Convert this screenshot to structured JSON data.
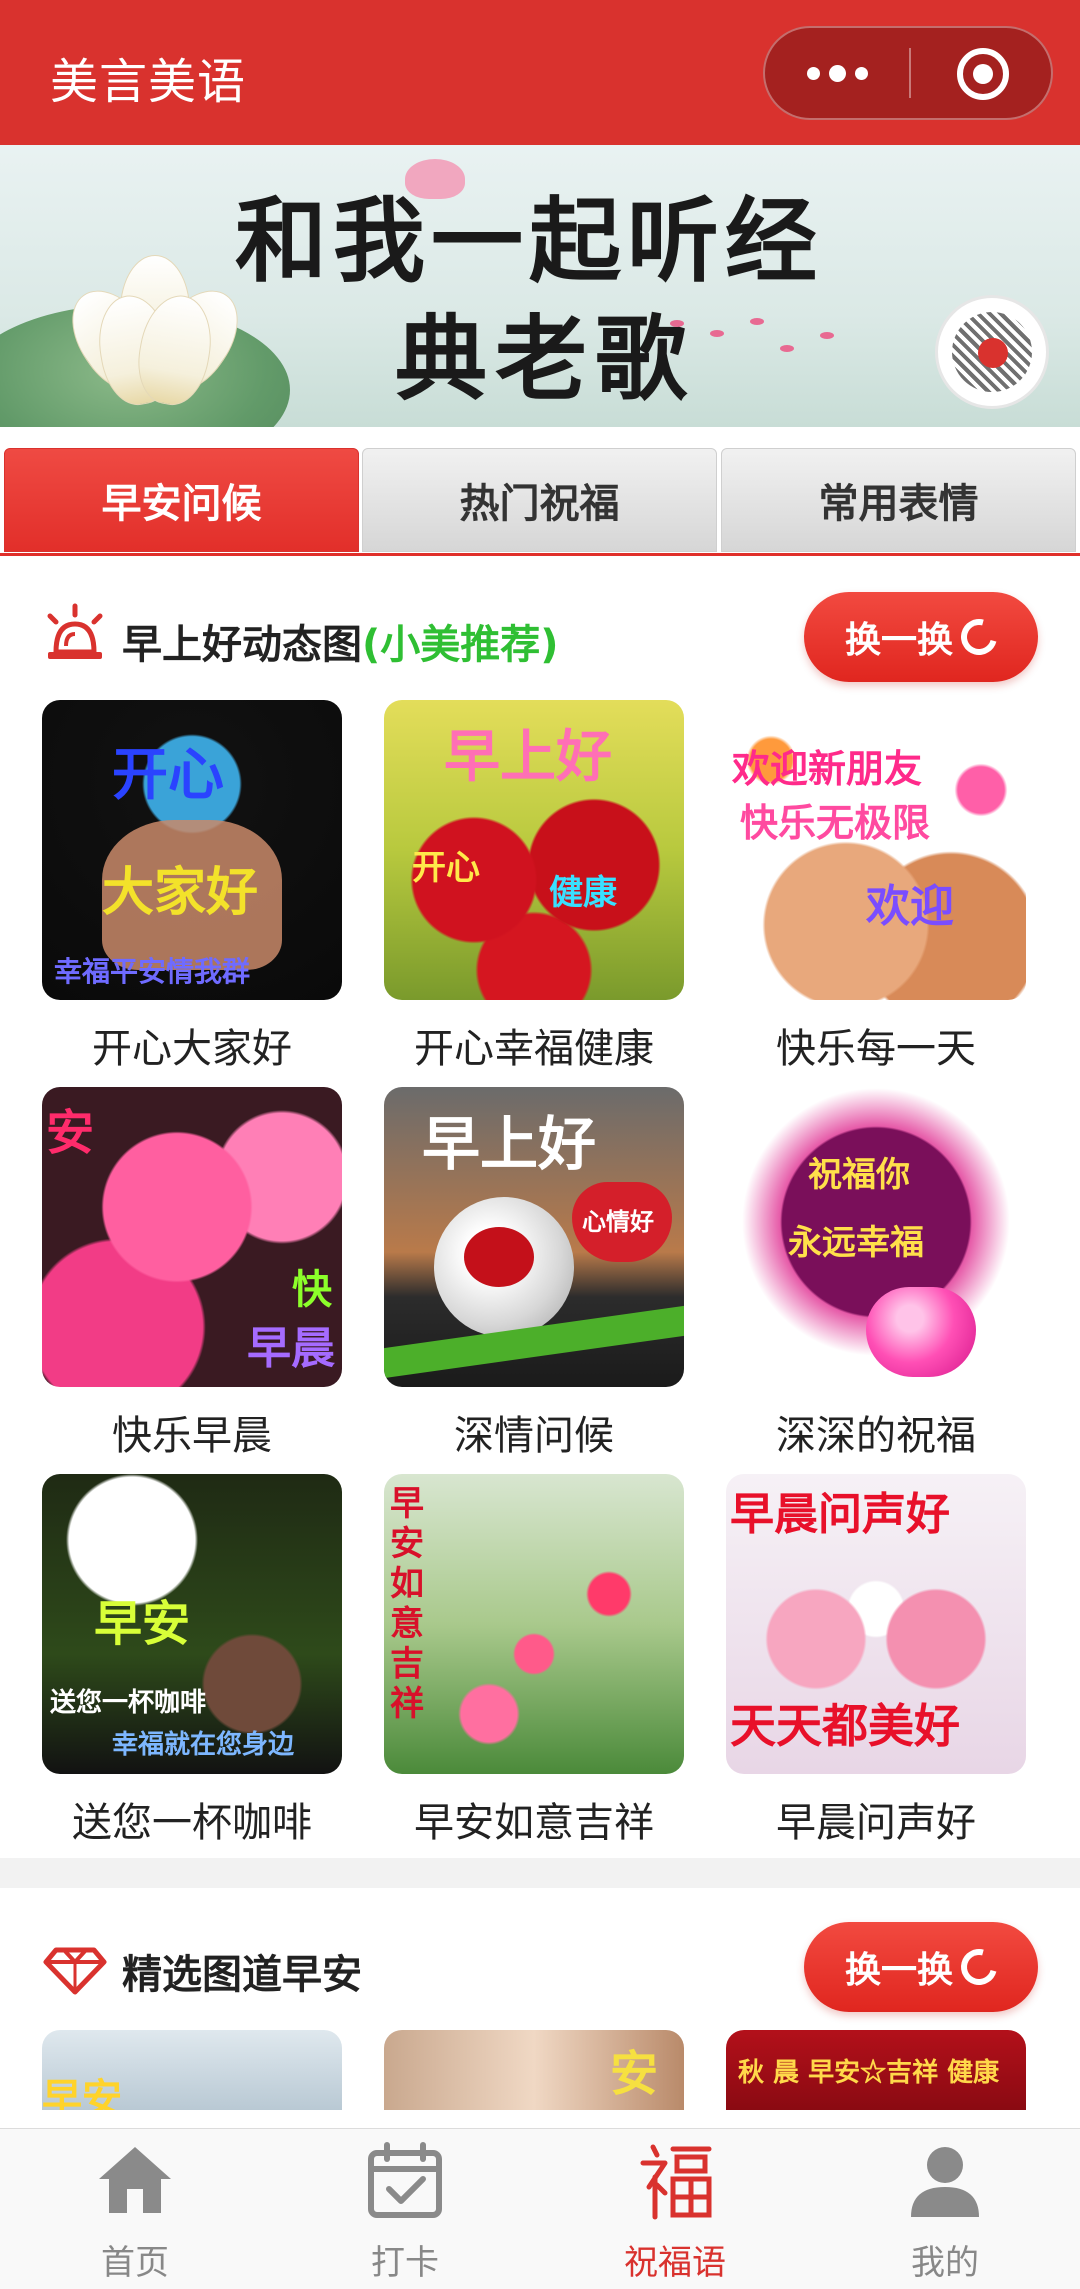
{
  "header": {
    "title": "美言美语",
    "more_icon": "more-dots-icon",
    "close_icon": "target-close-icon"
  },
  "banner": {
    "line1": "和我一起听经",
    "line2": "典老歌"
  },
  "tabs": [
    {
      "label": "早安问候",
      "active": true
    },
    {
      "label": "热门祝福",
      "active": false
    },
    {
      "label": "常用表情",
      "active": false
    }
  ],
  "section1": {
    "title_main": "早上好动态图",
    "title_accent": "(小美推荐)",
    "swap_label": "换一换",
    "items": [
      {
        "caption": "开心大家好",
        "overlay": [
          "开心",
          "大家好",
          "幸福平安情我群"
        ]
      },
      {
        "caption": "开心幸福健康",
        "overlay": [
          "早上好",
          "开心",
          "健康"
        ]
      },
      {
        "caption": "快乐每一天",
        "overlay": [
          "欢迎新朋友",
          "快乐无极限",
          "欢迎"
        ]
      },
      {
        "caption": "快乐早晨",
        "overlay": [
          "安",
          "快",
          "早晨"
        ]
      },
      {
        "caption": "深情问候",
        "overlay": [
          "早上好",
          "心情好"
        ]
      },
      {
        "caption": "深深的祝福",
        "overlay": [
          "祝福你",
          "永远幸福"
        ]
      },
      {
        "caption": "送您一杯咖啡",
        "overlay": [
          "早安",
          "送您一杯咖啡",
          "幸福就在您身边"
        ]
      },
      {
        "caption": "早安如意吉祥",
        "overlay": [
          "早安如意吉祥"
        ]
      },
      {
        "caption": "早晨问声好",
        "overlay": [
          "早晨问声好",
          "天天都美好"
        ]
      }
    ]
  },
  "section2": {
    "title": "精选图道早安",
    "swap_label": "换一换",
    "items": [
      {
        "overlay": "早安"
      },
      {
        "overlay": "安"
      },
      {
        "overlay": "秋 晨 早安☆吉祥 健康"
      }
    ]
  },
  "bottom_nav": [
    {
      "label": "首页",
      "icon": "home-icon",
      "active": false
    },
    {
      "label": "打卡",
      "icon": "calendar-check-icon",
      "active": false
    },
    {
      "label": "祝福语",
      "icon": "fu-blessing-icon",
      "active": true
    },
    {
      "label": "我的",
      "icon": "user-icon",
      "active": false
    }
  ],
  "colors": {
    "brand_red": "#d9322e",
    "accent_green": "#2fbf33",
    "nav_inactive": "#888888"
  }
}
